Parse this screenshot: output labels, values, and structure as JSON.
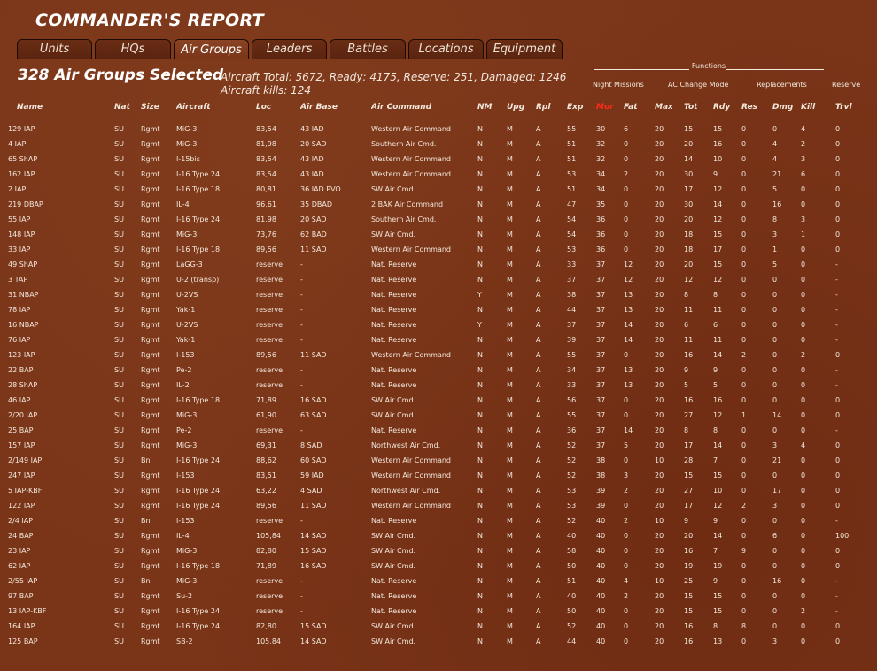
{
  "title": "COMMANDER'S REPORT",
  "tabs": [
    "Units",
    "HQs",
    "Air Groups",
    "Leaders",
    "Battles",
    "Locations",
    "Equipment"
  ],
  "active_tab": "Air Groups",
  "selected_label": "328 Air Groups Selected",
  "summary_line1": "Aircraft Total: 5672, Ready: 4175, Reserve: 251, Damaged: 1246",
  "summary_line2": "Aircraft kills: 124",
  "functions": {
    "title": "Functions",
    "buttons": [
      "Night Missions",
      "AC Change Mode",
      "Replacements",
      "Reserve"
    ]
  },
  "columns": [
    "Name",
    "Nat",
    "Size",
    "Aircraft",
    "Loc",
    "Air Base",
    "Air Command",
    "NM",
    "Upg",
    "Rpl",
    "Exp",
    "Mor",
    "Fat",
    "Max",
    "Tot",
    "Rdy",
    "Res",
    "Dmg",
    "Kill",
    "Trvl"
  ],
  "highlight_column": "Mor",
  "rows": [
    [
      "129 IAP",
      "SU",
      "Rgmt",
      "MiG-3",
      "83,54",
      "43 IAD",
      "Western Air Command",
      "N",
      "M",
      "A",
      "55",
      "30",
      "6",
      "20",
      "15",
      "15",
      "0",
      "0",
      "4",
      "0"
    ],
    [
      "4 IAP",
      "SU",
      "Rgmt",
      "MiG-3",
      "81,98",
      "20 SAD",
      "Southern Air Cmd.",
      "N",
      "M",
      "A",
      "51",
      "32",
      "0",
      "20",
      "20",
      "16",
      "0",
      "4",
      "2",
      "0"
    ],
    [
      "65 ShAP",
      "SU",
      "Rgmt",
      "I-15bis",
      "83,54",
      "43 IAD",
      "Western Air Command",
      "N",
      "M",
      "A",
      "51",
      "32",
      "0",
      "20",
      "14",
      "10",
      "0",
      "4",
      "3",
      "0"
    ],
    [
      "162 IAP",
      "SU",
      "Rgmt",
      "I-16 Type 24",
      "83,54",
      "43 IAD",
      "Western Air Command",
      "N",
      "M",
      "A",
      "53",
      "34",
      "2",
      "20",
      "30",
      "9",
      "0",
      "21",
      "6",
      "0"
    ],
    [
      "2 IAP",
      "SU",
      "Rgmt",
      "I-16 Type 18",
      "80,81",
      "36 IAD PVO",
      "SW Air Cmd.",
      "N",
      "M",
      "A",
      "51",
      "34",
      "0",
      "20",
      "17",
      "12",
      "0",
      "5",
      "0",
      "0"
    ],
    [
      "219 DBAP",
      "SU",
      "Rgmt",
      "IL-4",
      "96,61",
      "35 DBAD",
      "2 BAK Air Command",
      "N",
      "M",
      "A",
      "47",
      "35",
      "0",
      "20",
      "30",
      "14",
      "0",
      "16",
      "0",
      "0"
    ],
    [
      "55 IAP",
      "SU",
      "Rgmt",
      "I-16 Type 24",
      "81,98",
      "20 SAD",
      "Southern Air Cmd.",
      "N",
      "M",
      "A",
      "54",
      "36",
      "0",
      "20",
      "20",
      "12",
      "0",
      "8",
      "3",
      "0"
    ],
    [
      "148 IAP",
      "SU",
      "Rgmt",
      "MiG-3",
      "73,76",
      "62 BAD",
      "SW Air Cmd.",
      "N",
      "M",
      "A",
      "54",
      "36",
      "0",
      "20",
      "18",
      "15",
      "0",
      "3",
      "1",
      "0"
    ],
    [
      "33 IAP",
      "SU",
      "Rgmt",
      "I-16 Type 18",
      "89,56",
      "11 SAD",
      "Western Air Command",
      "N",
      "M",
      "A",
      "53",
      "36",
      "0",
      "20",
      "18",
      "17",
      "0",
      "1",
      "0",
      "0"
    ],
    [
      "49 ShAP",
      "SU",
      "Rgmt",
      "LaGG-3",
      "reserve",
      "-",
      "Nat. Reserve",
      "N",
      "M",
      "A",
      "33",
      "37",
      "12",
      "20",
      "20",
      "15",
      "0",
      "5",
      "0",
      "-"
    ],
    [
      "3 TAP",
      "SU",
      "Rgmt",
      "U-2 (transp)",
      "reserve",
      "-",
      "Nat. Reserve",
      "N",
      "M",
      "A",
      "37",
      "37",
      "12",
      "20",
      "12",
      "12",
      "0",
      "0",
      "0",
      "-"
    ],
    [
      "31 NBAP",
      "SU",
      "Rgmt",
      "U-2VS",
      "reserve",
      "-",
      "Nat. Reserve",
      "Y",
      "M",
      "A",
      "38",
      "37",
      "13",
      "20",
      "8",
      "8",
      "0",
      "0",
      "0",
      "-"
    ],
    [
      "78 IAP",
      "SU",
      "Rgmt",
      "Yak-1",
      "reserve",
      "-",
      "Nat. Reserve",
      "N",
      "M",
      "A",
      "44",
      "37",
      "13",
      "20",
      "11",
      "11",
      "0",
      "0",
      "0",
      "-"
    ],
    [
      "16 NBAP",
      "SU",
      "Rgmt",
      "U-2VS",
      "reserve",
      "-",
      "Nat. Reserve",
      "Y",
      "M",
      "A",
      "37",
      "37",
      "14",
      "20",
      "6",
      "6",
      "0",
      "0",
      "0",
      "-"
    ],
    [
      "76 IAP",
      "SU",
      "Rgmt",
      "Yak-1",
      "reserve",
      "-",
      "Nat. Reserve",
      "N",
      "M",
      "A",
      "39",
      "37",
      "14",
      "20",
      "11",
      "11",
      "0",
      "0",
      "0",
      "-"
    ],
    [
      "123 IAP",
      "SU",
      "Rgmt",
      "I-153",
      "89,56",
      "11 SAD",
      "Western Air Command",
      "N",
      "M",
      "A",
      "55",
      "37",
      "0",
      "20",
      "16",
      "14",
      "2",
      "0",
      "2",
      "0"
    ],
    [
      "22 BAP",
      "SU",
      "Rgmt",
      "Pe-2",
      "reserve",
      "-",
      "Nat. Reserve",
      "N",
      "M",
      "A",
      "34",
      "37",
      "13",
      "20",
      "9",
      "9",
      "0",
      "0",
      "0",
      "-"
    ],
    [
      "28 ShAP",
      "SU",
      "Rgmt",
      "IL-2",
      "reserve",
      "-",
      "Nat. Reserve",
      "N",
      "M",
      "A",
      "33",
      "37",
      "13",
      "20",
      "5",
      "5",
      "0",
      "0",
      "0",
      "-"
    ],
    [
      "46 IAP",
      "SU",
      "Rgmt",
      "I-16 Type 18",
      "71,89",
      "16 SAD",
      "SW Air Cmd.",
      "N",
      "M",
      "A",
      "56",
      "37",
      "0",
      "20",
      "16",
      "16",
      "0",
      "0",
      "0",
      "0"
    ],
    [
      "2/20 IAP",
      "SU",
      "Rgmt",
      "MiG-3",
      "61,90",
      "63 SAD",
      "SW Air Cmd.",
      "N",
      "M",
      "A",
      "55",
      "37",
      "0",
      "20",
      "27",
      "12",
      "1",
      "14",
      "0",
      "0"
    ],
    [
      "25 BAP",
      "SU",
      "Rgmt",
      "Pe-2",
      "reserve",
      "-",
      "Nat. Reserve",
      "N",
      "M",
      "A",
      "36",
      "37",
      "14",
      "20",
      "8",
      "8",
      "0",
      "0",
      "0",
      "-"
    ],
    [
      "157 IAP",
      "SU",
      "Rgmt",
      "MiG-3",
      "69,31",
      "8 SAD",
      "Northwest Air Cmd.",
      "N",
      "M",
      "A",
      "52",
      "37",
      "5",
      "20",
      "17",
      "14",
      "0",
      "3",
      "4",
      "0"
    ],
    [
      "2/149 IAP",
      "SU",
      "Bn",
      "I-16 Type 24",
      "88,62",
      "60 SAD",
      "Western Air Command",
      "N",
      "M",
      "A",
      "52",
      "38",
      "0",
      "10",
      "28",
      "7",
      "0",
      "21",
      "0",
      "0"
    ],
    [
      "247 IAP",
      "SU",
      "Rgmt",
      "I-153",
      "83,51",
      "59 IAD",
      "Western Air Command",
      "N",
      "M",
      "A",
      "52",
      "38",
      "3",
      "20",
      "15",
      "15",
      "0",
      "0",
      "0",
      "0"
    ],
    [
      "5 IAP-KBF",
      "SU",
      "Rgmt",
      "I-16 Type 24",
      "63,22",
      "4 SAD",
      "Northwest Air Cmd.",
      "N",
      "M",
      "A",
      "53",
      "39",
      "2",
      "20",
      "27",
      "10",
      "0",
      "17",
      "0",
      "0"
    ],
    [
      "122 IAP",
      "SU",
      "Rgmt",
      "I-16 Type 24",
      "89,56",
      "11 SAD",
      "Western Air Command",
      "N",
      "M",
      "A",
      "53",
      "39",
      "0",
      "20",
      "17",
      "12",
      "2",
      "3",
      "0",
      "0"
    ],
    [
      "2/4 IAP",
      "SU",
      "Bn",
      "I-153",
      "reserve",
      "-",
      "Nat. Reserve",
      "N",
      "M",
      "A",
      "52",
      "40",
      "2",
      "10",
      "9",
      "9",
      "0",
      "0",
      "0",
      "-"
    ],
    [
      "24 BAP",
      "SU",
      "Rgmt",
      "IL-4",
      "105,84",
      "14 SAD",
      "SW Air Cmd.",
      "N",
      "M",
      "A",
      "40",
      "40",
      "0",
      "20",
      "20",
      "14",
      "0",
      "6",
      "0",
      "100"
    ],
    [
      "23 IAP",
      "SU",
      "Rgmt",
      "MiG-3",
      "82,80",
      "15 SAD",
      "SW Air Cmd.",
      "N",
      "M",
      "A",
      "58",
      "40",
      "0",
      "20",
      "16",
      "7",
      "9",
      "0",
      "0",
      "0"
    ],
    [
      "62 IAP",
      "SU",
      "Rgmt",
      "I-16 Type 18",
      "71,89",
      "16 SAD",
      "SW Air Cmd.",
      "N",
      "M",
      "A",
      "50",
      "40",
      "0",
      "20",
      "19",
      "19",
      "0",
      "0",
      "0",
      "0"
    ],
    [
      "2/55 IAP",
      "SU",
      "Bn",
      "MiG-3",
      "reserve",
      "-",
      "Nat. Reserve",
      "N",
      "M",
      "A",
      "51",
      "40",
      "4",
      "10",
      "25",
      "9",
      "0",
      "16",
      "0",
      "-"
    ],
    [
      "97 BAP",
      "SU",
      "Rgmt",
      "Su-2",
      "reserve",
      "-",
      "Nat. Reserve",
      "N",
      "M",
      "A",
      "40",
      "40",
      "2",
      "20",
      "15",
      "15",
      "0",
      "0",
      "0",
      "-"
    ],
    [
      "13 IAP-KBF",
      "SU",
      "Rgmt",
      "I-16 Type 24",
      "reserve",
      "-",
      "Nat. Reserve",
      "N",
      "M",
      "A",
      "50",
      "40",
      "0",
      "20",
      "15",
      "15",
      "0",
      "0",
      "2",
      "-"
    ],
    [
      "164 IAP",
      "SU",
      "Rgmt",
      "I-16 Type 24",
      "82,80",
      "15 SAD",
      "SW Air Cmd.",
      "N",
      "M",
      "A",
      "52",
      "40",
      "0",
      "20",
      "16",
      "8",
      "8",
      "0",
      "0",
      "0"
    ],
    [
      "125 BAP",
      "SU",
      "Rgmt",
      "SB-2",
      "105,84",
      "14 SAD",
      "SW Air Cmd.",
      "N",
      "M",
      "A",
      "44",
      "40",
      "0",
      "20",
      "16",
      "13",
      "0",
      "3",
      "0",
      "0"
    ]
  ]
}
